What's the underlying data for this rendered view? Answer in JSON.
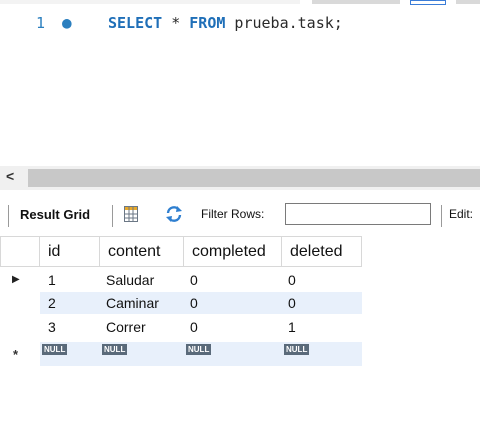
{
  "editor": {
    "line_number": "1",
    "bullet": "●",
    "query_parts": {
      "kw_select": "SELECT",
      "star": " * ",
      "kw_from": "FROM",
      "target": " prueba.task;"
    }
  },
  "hscroll": {
    "left_arrow": "<"
  },
  "toolbar": {
    "result_grid_label": "Result Grid",
    "filter_rows_label": "Filter Rows:",
    "filter_value": "",
    "edit_label": "Edit:"
  },
  "grid": {
    "columns": [
      "id",
      "content",
      "completed",
      "deleted"
    ],
    "rows": [
      {
        "id": "1",
        "content": "Saludar",
        "completed": "0",
        "deleted": "0"
      },
      {
        "id": "2",
        "content": "Caminar",
        "completed": "0",
        "deleted": "0"
      },
      {
        "id": "3",
        "content": "Correr",
        "completed": "0",
        "deleted": "1"
      }
    ],
    "new_row_marker": "*",
    "null_label": "NULL",
    "current_row_marker": "▶"
  },
  "colors": {
    "selected_row_bg": "#e8f0fb",
    "keyword": "#1f6fb8",
    "null_badge": "#5a6a7a"
  },
  "icons": [
    "grid-icon",
    "refresh-icon"
  ]
}
